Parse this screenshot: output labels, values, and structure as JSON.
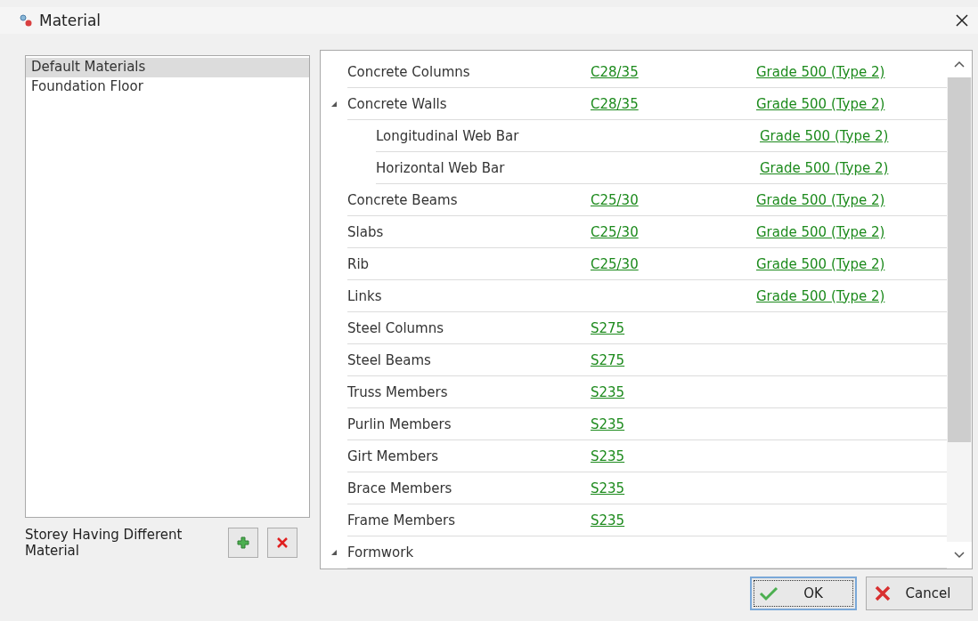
{
  "window": {
    "title": "Material"
  },
  "storeys": {
    "items": [
      {
        "label": "Default Materials",
        "selected": true
      },
      {
        "label": "Foundation Floor",
        "selected": false
      }
    ],
    "caption": "Storey Having Different Material"
  },
  "rows": [
    {
      "name": "Concrete Columns",
      "concrete": "C28/35",
      "steel": "Grade 500 (Type 2)"
    },
    {
      "name": "Concrete Walls",
      "concrete": "C28/35",
      "steel": "Grade 500 (Type 2)",
      "expanded": true,
      "children": [
        {
          "name": "Longitudinal Web Bar",
          "steel": "Grade 500 (Type 2)"
        },
        {
          "name": "Horizontal Web Bar",
          "steel": "Grade 500 (Type 2)"
        }
      ]
    },
    {
      "name": "Concrete Beams",
      "concrete": "C25/30",
      "steel": "Grade 500 (Type 2)"
    },
    {
      "name": "Slabs",
      "concrete": "C25/30",
      "steel": "Grade 500 (Type 2)"
    },
    {
      "name": "Rib",
      "concrete": "C25/30",
      "steel": "Grade 500 (Type 2)"
    },
    {
      "name": "Links",
      "steel": "Grade 500 (Type 2)"
    },
    {
      "name": "Steel Columns",
      "concrete": "S275"
    },
    {
      "name": "Steel Beams",
      "concrete": "S275"
    },
    {
      "name": "Truss Members",
      "concrete": "S235"
    },
    {
      "name": "Purlin Members",
      "concrete": "S235"
    },
    {
      "name": "Girt Members",
      "concrete": "S235"
    },
    {
      "name": "Brace Members",
      "concrete": "S235"
    },
    {
      "name": "Frame Members",
      "concrete": "S235"
    },
    {
      "name": "Formwork",
      "expanded": true
    }
  ],
  "buttons": [
    {
      "label": "OK",
      "kind": "ok"
    },
    {
      "label": "Cancel",
      "kind": "cancel"
    }
  ]
}
